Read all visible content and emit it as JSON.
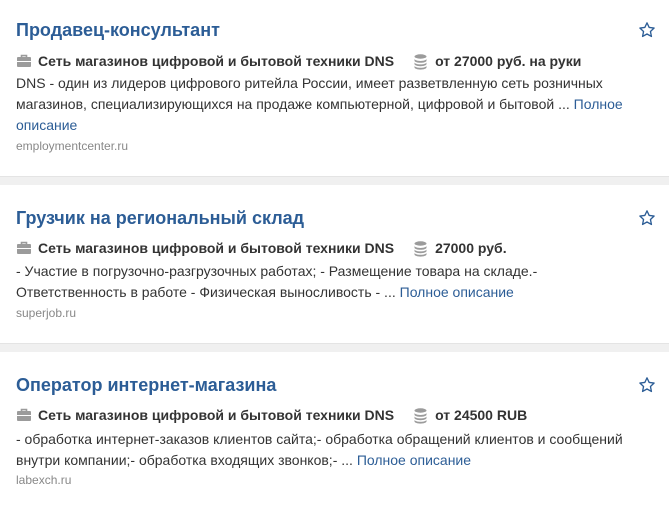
{
  "colors": {
    "title": "#2c5d96",
    "text": "#333333",
    "source": "#888888",
    "icon": "#9b9b9b",
    "separator": "#f0f0f0"
  },
  "icons": {
    "company": "briefcase-icon",
    "salary": "coins-icon",
    "favorite": "star-icon"
  },
  "jobs": [
    {
      "title": "Продавец-консультант",
      "company": "Сеть магазинов цифровой и бытовой техники DNS",
      "salary": "от 27000 руб. на руки",
      "description": "DNS - один из лидеров цифрового ритейла России, имеет разветвленную сеть розничных магазинов, специализирующихся на продаже компьютерной, цифровой и бытовой ...",
      "more": "Полное описание",
      "source": "employmentcenter.ru"
    },
    {
      "title": "Грузчик на региональный склад",
      "company": "Сеть магазинов цифровой и бытовой техники DNS",
      "salary": "27000 руб.",
      "description": "- Участие в погрузочно-разгрузочных работах; - Размещение товара на складе.- Ответственность в работе - Физическая выносливость - ...",
      "more": "Полное описание",
      "source": "superjob.ru"
    },
    {
      "title": "Оператор интернет-магазина",
      "company": "Сеть магазинов цифровой и бытовой техники DNS",
      "salary": "от 24500 RUB",
      "description": "- обработка интернет-заказов клиентов сайта;- обработка обращений клиентов и сообщений внутри компании;- обработка входящих звонков;- ...",
      "more": "Полное описание",
      "source": "labexch.ru"
    }
  ]
}
